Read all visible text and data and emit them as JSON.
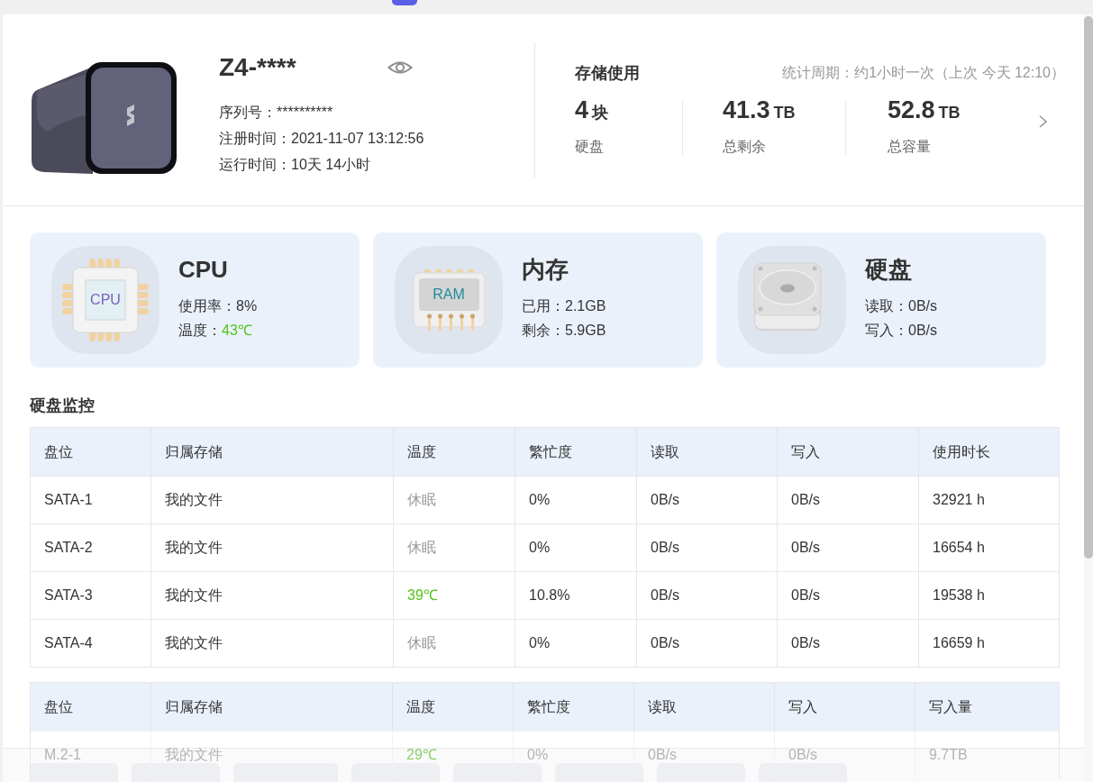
{
  "device": {
    "name": "Z4-****",
    "info": [
      {
        "label": "序列号：",
        "value": "**********"
      },
      {
        "label": "注册时间：",
        "value": "2021-11-07 13:12:56"
      },
      {
        "label": "运行时间：",
        "value": "10天 14小时"
      }
    ]
  },
  "storage": {
    "title": "存储使用",
    "period": "统计周期：约1小时一次（上次 今天 12:10）",
    "stats": [
      {
        "value": "4",
        "unit": "块",
        "label": "硬盘"
      },
      {
        "value": "41.3",
        "unit": "TB",
        "label": "总剩余"
      },
      {
        "value": "52.8",
        "unit": "TB",
        "label": "总容量"
      }
    ]
  },
  "cards": [
    {
      "kind": "cpu",
      "title": "CPU",
      "icon_label": "CPU",
      "lines": [
        {
          "label": "使用率：",
          "value": "8%",
          "highlighted": false
        },
        {
          "label": "温度：",
          "value": "43℃",
          "highlighted": true
        }
      ]
    },
    {
      "kind": "ram",
      "title": "内存",
      "icon_label": "RAM",
      "lines": [
        {
          "label": "已用：",
          "value": "2.1GB",
          "highlighted": false
        },
        {
          "label": "剩余：",
          "value": "5.9GB",
          "highlighted": false
        }
      ]
    },
    {
      "kind": "disk",
      "title": "硬盘",
      "lines": [
        {
          "label": "读取：",
          "value": "0B/s",
          "highlighted": false
        },
        {
          "label": "写入：",
          "value": "0B/s",
          "highlighted": false
        }
      ]
    }
  ],
  "monitor": {
    "title": "硬盘监控",
    "tables": [
      {
        "columns": [
          "盘位",
          "归属存储",
          "温度",
          "繁忙度",
          "读取",
          "写入",
          "使用时长"
        ],
        "rows": [
          {
            "cells": [
              "SATA-1",
              "我的文件",
              "休眠",
              "0%",
              "0B/s",
              "0B/s",
              "32921 h"
            ],
            "sleeping": true,
            "obscured": false
          },
          {
            "cells": [
              "SATA-2",
              "我的文件",
              "休眠",
              "0%",
              "0B/s",
              "0B/s",
              "16654 h"
            ],
            "sleeping": true,
            "obscured": false
          },
          {
            "cells": [
              "SATA-3",
              "我的文件",
              "39℃",
              "10.8%",
              "0B/s",
              "0B/s",
              "19538 h"
            ],
            "sleeping": false,
            "obscured": false
          },
          {
            "cells": [
              "SATA-4",
              "我的文件",
              "休眠",
              "0%",
              "0B/s",
              "0B/s",
              "16659 h"
            ],
            "sleeping": true,
            "obscured": false
          }
        ]
      },
      {
        "columns": [
          "盘位",
          "归属存储",
          "温度",
          "繁忙度",
          "读取",
          "写入",
          "写入量"
        ],
        "rows": [
          {
            "cells": [
              "M.2-1",
              "我的文件",
              "29℃",
              "0%",
              "0B/s",
              "0B/s",
              "9.7TB"
            ],
            "sleeping": false,
            "obscured": true
          }
        ]
      }
    ]
  },
  "bottom_bar": {
    "buttons": [
      {
        "kind": "narrow"
      },
      {
        "kind": "narrow"
      },
      {
        "kind": "wide"
      },
      {
        "kind": "narrow"
      },
      {
        "kind": "narrow"
      },
      {
        "kind": "narrow"
      },
      {
        "kind": "narrow"
      },
      {
        "kind": "narrow"
      }
    ]
  }
}
